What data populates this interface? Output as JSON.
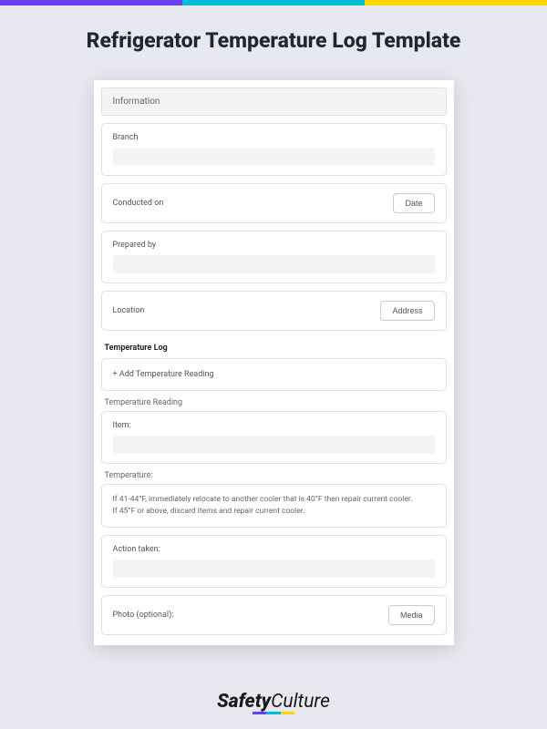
{
  "page_title": "Refrigerator Temperature Log Template",
  "info_header": "Information",
  "fields": {
    "branch": "Branch",
    "conducted_on": "Conducted on",
    "date_btn": "Date",
    "prepared_by": "Prepared by",
    "location": "Location",
    "address_btn": "Address"
  },
  "temp_log": {
    "title": "Temperature Log",
    "add_btn": "+ Add Temperature Reading",
    "reading_label": "Temperature Reading",
    "item": "Item:",
    "temp_label": "Temperature:",
    "instruction1": "If 41-44°F, immediately relocate to another cooler that is 40°F then repair current cooler.",
    "instruction2": "If 45°F or above, discard items and repair current cooler.",
    "action": "Action taken:",
    "photo": "Photo (optional):",
    "media_btn": "Media"
  },
  "brand": {
    "part1": "Safety",
    "part2": "Culture"
  }
}
